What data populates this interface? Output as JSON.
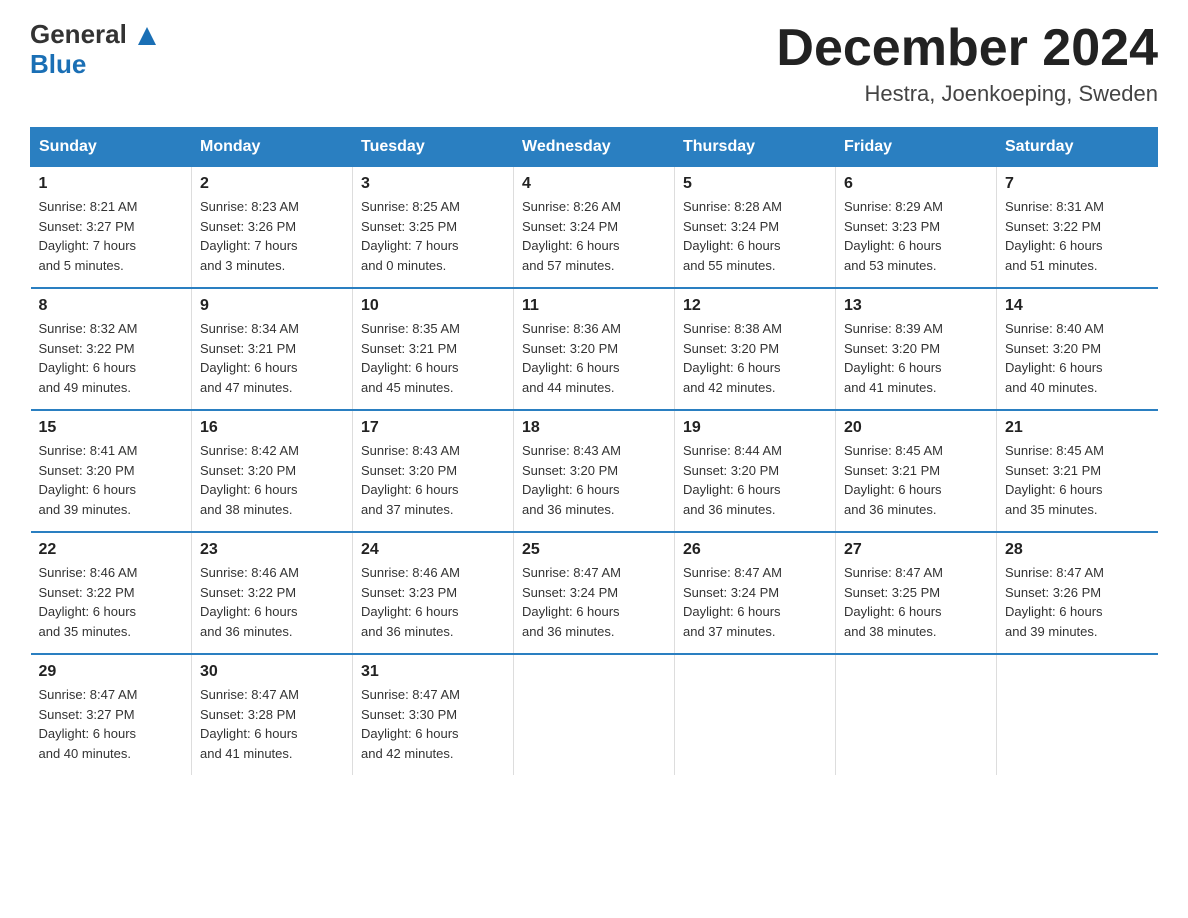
{
  "header": {
    "month_title": "December 2024",
    "location": "Hestra, Joenkoeping, Sweden",
    "logo_general": "General",
    "logo_blue": "Blue"
  },
  "days_of_week": [
    "Sunday",
    "Monday",
    "Tuesday",
    "Wednesday",
    "Thursday",
    "Friday",
    "Saturday"
  ],
  "weeks": [
    [
      {
        "day": "1",
        "sunrise": "8:21 AM",
        "sunset": "3:27 PM",
        "daylight": "7 hours and 5 minutes."
      },
      {
        "day": "2",
        "sunrise": "8:23 AM",
        "sunset": "3:26 PM",
        "daylight": "7 hours and 3 minutes."
      },
      {
        "day": "3",
        "sunrise": "8:25 AM",
        "sunset": "3:25 PM",
        "daylight": "7 hours and 0 minutes."
      },
      {
        "day": "4",
        "sunrise": "8:26 AM",
        "sunset": "3:24 PM",
        "daylight": "6 hours and 57 minutes."
      },
      {
        "day": "5",
        "sunrise": "8:28 AM",
        "sunset": "3:24 PM",
        "daylight": "6 hours and 55 minutes."
      },
      {
        "day": "6",
        "sunrise": "8:29 AM",
        "sunset": "3:23 PM",
        "daylight": "6 hours and 53 minutes."
      },
      {
        "day": "7",
        "sunrise": "8:31 AM",
        "sunset": "3:22 PM",
        "daylight": "6 hours and 51 minutes."
      }
    ],
    [
      {
        "day": "8",
        "sunrise": "8:32 AM",
        "sunset": "3:22 PM",
        "daylight": "6 hours and 49 minutes."
      },
      {
        "day": "9",
        "sunrise": "8:34 AM",
        "sunset": "3:21 PM",
        "daylight": "6 hours and 47 minutes."
      },
      {
        "day": "10",
        "sunrise": "8:35 AM",
        "sunset": "3:21 PM",
        "daylight": "6 hours and 45 minutes."
      },
      {
        "day": "11",
        "sunrise": "8:36 AM",
        "sunset": "3:20 PM",
        "daylight": "6 hours and 44 minutes."
      },
      {
        "day": "12",
        "sunrise": "8:38 AM",
        "sunset": "3:20 PM",
        "daylight": "6 hours and 42 minutes."
      },
      {
        "day": "13",
        "sunrise": "8:39 AM",
        "sunset": "3:20 PM",
        "daylight": "6 hours and 41 minutes."
      },
      {
        "day": "14",
        "sunrise": "8:40 AM",
        "sunset": "3:20 PM",
        "daylight": "6 hours and 40 minutes."
      }
    ],
    [
      {
        "day": "15",
        "sunrise": "8:41 AM",
        "sunset": "3:20 PM",
        "daylight": "6 hours and 39 minutes."
      },
      {
        "day": "16",
        "sunrise": "8:42 AM",
        "sunset": "3:20 PM",
        "daylight": "6 hours and 38 minutes."
      },
      {
        "day": "17",
        "sunrise": "8:43 AM",
        "sunset": "3:20 PM",
        "daylight": "6 hours and 37 minutes."
      },
      {
        "day": "18",
        "sunrise": "8:43 AM",
        "sunset": "3:20 PM",
        "daylight": "6 hours and 36 minutes."
      },
      {
        "day": "19",
        "sunrise": "8:44 AM",
        "sunset": "3:20 PM",
        "daylight": "6 hours and 36 minutes."
      },
      {
        "day": "20",
        "sunrise": "8:45 AM",
        "sunset": "3:21 PM",
        "daylight": "6 hours and 36 minutes."
      },
      {
        "day": "21",
        "sunrise": "8:45 AM",
        "sunset": "3:21 PM",
        "daylight": "6 hours and 35 minutes."
      }
    ],
    [
      {
        "day": "22",
        "sunrise": "8:46 AM",
        "sunset": "3:22 PM",
        "daylight": "6 hours and 35 minutes."
      },
      {
        "day": "23",
        "sunrise": "8:46 AM",
        "sunset": "3:22 PM",
        "daylight": "6 hours and 36 minutes."
      },
      {
        "day": "24",
        "sunrise": "8:46 AM",
        "sunset": "3:23 PM",
        "daylight": "6 hours and 36 minutes."
      },
      {
        "day": "25",
        "sunrise": "8:47 AM",
        "sunset": "3:24 PM",
        "daylight": "6 hours and 36 minutes."
      },
      {
        "day": "26",
        "sunrise": "8:47 AM",
        "sunset": "3:24 PM",
        "daylight": "6 hours and 37 minutes."
      },
      {
        "day": "27",
        "sunrise": "8:47 AM",
        "sunset": "3:25 PM",
        "daylight": "6 hours and 38 minutes."
      },
      {
        "day": "28",
        "sunrise": "8:47 AM",
        "sunset": "3:26 PM",
        "daylight": "6 hours and 39 minutes."
      }
    ],
    [
      {
        "day": "29",
        "sunrise": "8:47 AM",
        "sunset": "3:27 PM",
        "daylight": "6 hours and 40 minutes."
      },
      {
        "day": "30",
        "sunrise": "8:47 AM",
        "sunset": "3:28 PM",
        "daylight": "6 hours and 41 minutes."
      },
      {
        "day": "31",
        "sunrise": "8:47 AM",
        "sunset": "3:30 PM",
        "daylight": "6 hours and 42 minutes."
      },
      {
        "day": "",
        "sunrise": "",
        "sunset": "",
        "daylight": ""
      },
      {
        "day": "",
        "sunrise": "",
        "sunset": "",
        "daylight": ""
      },
      {
        "day": "",
        "sunrise": "",
        "sunset": "",
        "daylight": ""
      },
      {
        "day": "",
        "sunrise": "",
        "sunset": "",
        "daylight": ""
      }
    ]
  ],
  "labels": {
    "sunrise_prefix": "Sunrise: ",
    "sunset_prefix": "Sunset: ",
    "daylight_prefix": "Daylight: "
  },
  "colors": {
    "header_bg": "#2a7fc1",
    "border": "#2a7fc1"
  }
}
